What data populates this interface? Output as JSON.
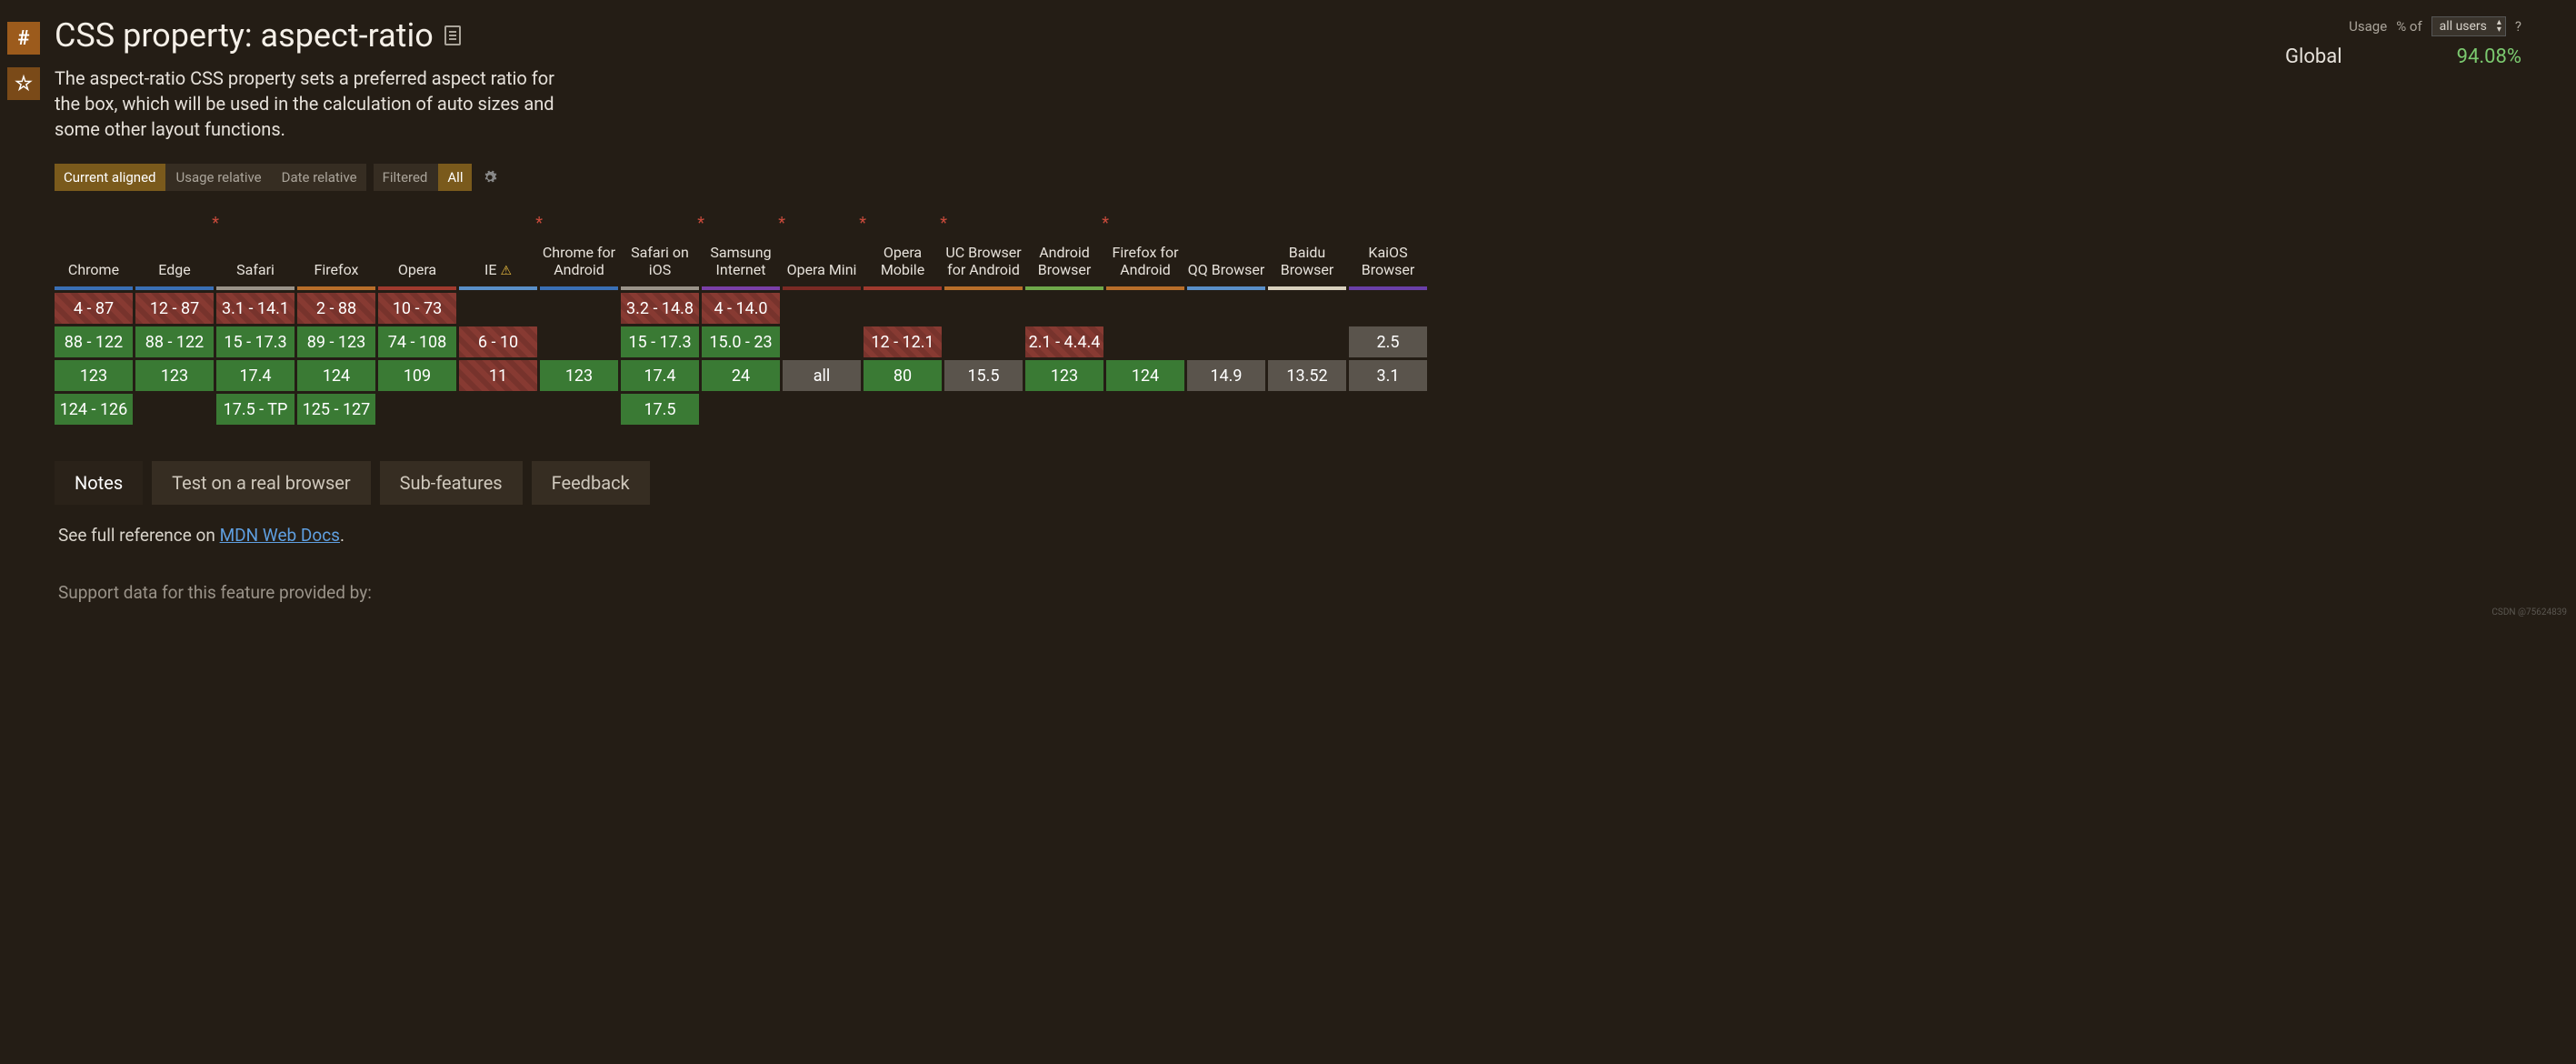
{
  "title": "CSS property: aspect-ratio",
  "description": "The aspect-ratio CSS property sets a preferred aspect ratio for the box, which will be used in the calculation of auto sizes and some other layout functions.",
  "usage": {
    "label": "Usage",
    "percent_of": "% of",
    "select_value": "all users",
    "help": "?",
    "global_label": "Global",
    "global_value": "94.08%"
  },
  "toolbar": {
    "group1": [
      {
        "label": "Current aligned",
        "active": true
      },
      {
        "label": "Usage relative",
        "active": false
      },
      {
        "label": "Date relative",
        "active": false
      }
    ],
    "group2": [
      {
        "label": "Filtered",
        "active": false
      },
      {
        "label": "All",
        "active": true
      }
    ]
  },
  "columns": [
    {
      "name": "Chrome",
      "bar": "bar-blue",
      "asterisk": false,
      "cells": [
        {
          "t": "4 - 87",
          "s": "red"
        },
        {
          "t": "88 - 122",
          "s": "green"
        },
        {
          "t": "123",
          "s": "green"
        },
        {
          "t": "124 - 126",
          "s": "green"
        }
      ]
    },
    {
      "name": "Edge",
      "bar": "bar-blue",
      "asterisk": true,
      "cells": [
        {
          "t": "12 - 87",
          "s": "red"
        },
        {
          "t": "88 - 122",
          "s": "green"
        },
        {
          "t": "123",
          "s": "green"
        },
        {
          "t": "",
          "s": "empty"
        }
      ]
    },
    {
      "name": "Safari",
      "bar": "bar-grey",
      "asterisk": false,
      "cells": [
        {
          "t": "3.1 - 14.1",
          "s": "red"
        },
        {
          "t": "15 - 17.3",
          "s": "green"
        },
        {
          "t": "17.4",
          "s": "green"
        },
        {
          "t": "17.5 - TP",
          "s": "green"
        }
      ]
    },
    {
      "name": "Firefox",
      "bar": "bar-orange",
      "asterisk": false,
      "cells": [
        {
          "t": "2 - 88",
          "s": "red"
        },
        {
          "t": "89 - 123",
          "s": "green"
        },
        {
          "t": "124",
          "s": "green"
        },
        {
          "t": "125 - 127",
          "s": "green"
        }
      ]
    },
    {
      "name": "Opera",
      "bar": "bar-red",
      "asterisk": false,
      "cells": [
        {
          "t": "10 - 73",
          "s": "red"
        },
        {
          "t": "74 - 108",
          "s": "green"
        },
        {
          "t": "109",
          "s": "green"
        },
        {
          "t": "",
          "s": "empty"
        }
      ]
    },
    {
      "name": "IE",
      "bar": "bar-ltblue",
      "asterisk": true,
      "warn": true,
      "cells": [
        {
          "t": "",
          "s": "empty"
        },
        {
          "t": "6 - 10",
          "s": "red"
        },
        {
          "t": "11",
          "s": "red"
        },
        {
          "t": "",
          "s": "empty"
        }
      ]
    },
    {
      "name": "Chrome for Android",
      "bar": "bar-blue",
      "asterisk": false,
      "cells": [
        {
          "t": "",
          "s": "empty"
        },
        {
          "t": "",
          "s": "empty"
        },
        {
          "t": "123",
          "s": "green"
        },
        {
          "t": "",
          "s": "empty"
        }
      ]
    },
    {
      "name": "Safari on iOS",
      "bar": "bar-grey",
      "asterisk": true,
      "cells": [
        {
          "t": "3.2 - 14.8",
          "s": "red"
        },
        {
          "t": "15 - 17.3",
          "s": "green"
        },
        {
          "t": "17.4",
          "s": "green"
        },
        {
          "t": "17.5",
          "s": "green"
        }
      ]
    },
    {
      "name": "Samsung Internet",
      "bar": "bar-purple",
      "asterisk": true,
      "cells": [
        {
          "t": "4 - 14.0",
          "s": "red"
        },
        {
          "t": "15.0 - 23",
          "s": "green"
        },
        {
          "t": "24",
          "s": "green"
        },
        {
          "t": "",
          "s": "empty"
        }
      ]
    },
    {
      "name": "Opera Mini",
      "bar": "bar-darkred",
      "asterisk": true,
      "cells": [
        {
          "t": "",
          "s": "empty"
        },
        {
          "t": "",
          "s": "empty"
        },
        {
          "t": "all",
          "s": "grey"
        },
        {
          "t": "",
          "s": "empty"
        }
      ]
    },
    {
      "name": "Opera Mobile",
      "bar": "bar-red",
      "asterisk": true,
      "cells": [
        {
          "t": "",
          "s": "empty"
        },
        {
          "t": "12 - 12.1",
          "s": "red"
        },
        {
          "t": "80",
          "s": "green"
        },
        {
          "t": "",
          "s": "empty"
        }
      ]
    },
    {
      "name": "UC Browser for Android",
      "bar": "bar-orange",
      "asterisk": false,
      "cells": [
        {
          "t": "",
          "s": "empty"
        },
        {
          "t": "",
          "s": "empty"
        },
        {
          "t": "15.5",
          "s": "grey"
        },
        {
          "t": "",
          "s": "empty"
        }
      ]
    },
    {
      "name": "Android Browser",
      "bar": "bar-green",
      "asterisk": true,
      "cells": [
        {
          "t": "",
          "s": "empty"
        },
        {
          "t": "2.1 - 4.4.4",
          "s": "red"
        },
        {
          "t": "123",
          "s": "green"
        },
        {
          "t": "",
          "s": "empty"
        }
      ]
    },
    {
      "name": "Firefox for Android",
      "bar": "bar-orange",
      "asterisk": false,
      "cells": [
        {
          "t": "",
          "s": "empty"
        },
        {
          "t": "",
          "s": "empty"
        },
        {
          "t": "124",
          "s": "green"
        },
        {
          "t": "",
          "s": "empty"
        }
      ]
    },
    {
      "name": "QQ Browser",
      "bar": "bar-ltblue",
      "asterisk": false,
      "cells": [
        {
          "t": "",
          "s": "empty"
        },
        {
          "t": "",
          "s": "empty"
        },
        {
          "t": "14.9",
          "s": "grey"
        },
        {
          "t": "",
          "s": "empty"
        }
      ]
    },
    {
      "name": "Baidu Browser",
      "bar": "bar-cream",
      "asterisk": false,
      "cells": [
        {
          "t": "",
          "s": "empty"
        },
        {
          "t": "",
          "s": "empty"
        },
        {
          "t": "13.52",
          "s": "grey"
        },
        {
          "t": "",
          "s": "empty"
        }
      ]
    },
    {
      "name": "KaiOS Browser",
      "bar": "bar-violet",
      "asterisk": false,
      "cells": [
        {
          "t": "",
          "s": "empty"
        },
        {
          "t": "2.5",
          "s": "grey"
        },
        {
          "t": "3.1",
          "s": "grey"
        },
        {
          "t": "",
          "s": "empty"
        }
      ]
    }
  ],
  "tabs": [
    {
      "label": "Notes",
      "active": true
    },
    {
      "label": "Test on a real browser",
      "active": false
    },
    {
      "label": "Sub-features",
      "active": false
    },
    {
      "label": "Feedback",
      "active": false
    }
  ],
  "notes": {
    "prefix": "See full reference on ",
    "link_text": "MDN Web Docs",
    "suffix": "."
  },
  "footer": "Support data for this feature provided by:",
  "watermark": "CSDN @75624839"
}
